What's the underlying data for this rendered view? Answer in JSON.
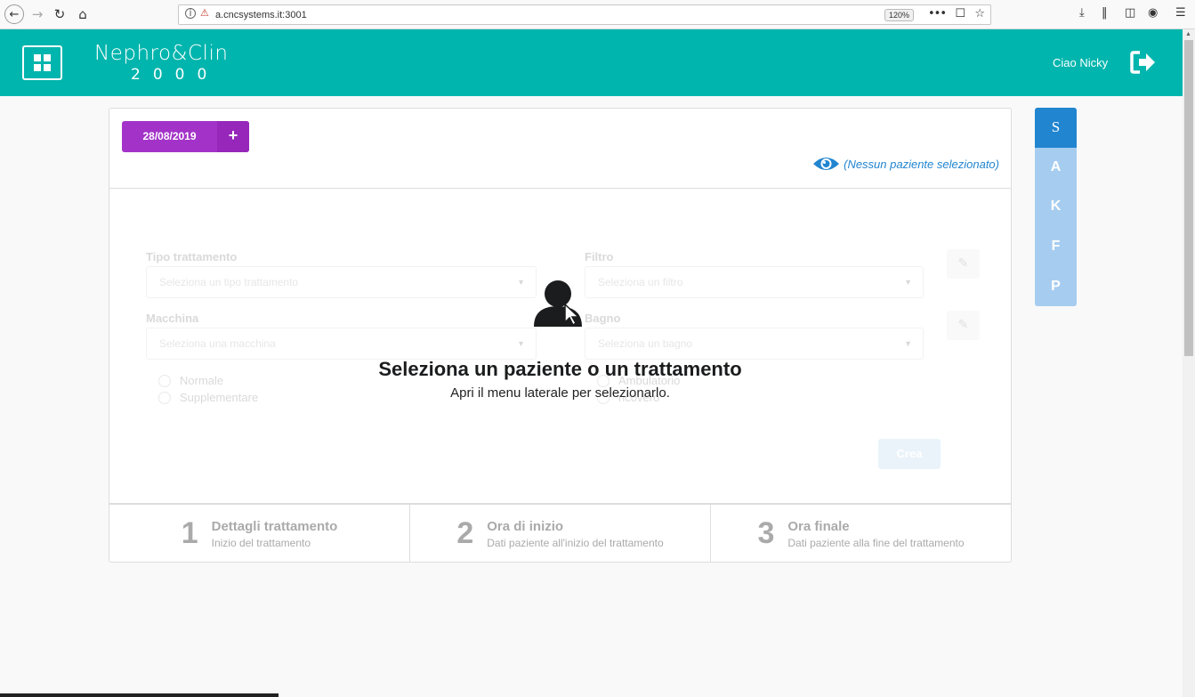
{
  "browser": {
    "url": "a.cncsystems.it:3001",
    "zoom": "120%",
    "more_glyph": "•••"
  },
  "header": {
    "logo_top": "Nephro&Clin",
    "logo_bottom": "2000",
    "greeting": "Ciao Nicky"
  },
  "panel": {
    "date_label": "28/08/2019",
    "add_glyph": "+",
    "patient_status": "(Nessun paziente selezionato)"
  },
  "form": {
    "treatment_label": "Tipo trattamento",
    "treatment_placeholder": "Seleziona un tipo trattamento",
    "filter_label": "Filtro",
    "filter_placeholder": "Seleziona un filtro",
    "machine_label": "Macchina",
    "machine_placeholder": "Seleziona una macchina",
    "bath_label": "Bagno",
    "bath_placeholder": "Seleziona un bagno",
    "radio_normal": "Normale",
    "radio_extra": "Supplementare",
    "radio_ambulatorio": "Ambulatorio",
    "radio_ricovero": "ricovero",
    "create_label": "Crea"
  },
  "overlay": {
    "title": "Seleziona un paziente o un trattamento",
    "subtitle": "Apri il menu laterale per selezionarlo."
  },
  "steps": [
    {
      "num": "1",
      "title": "Dettagli trattamento",
      "desc": "Inizio del trattamento"
    },
    {
      "num": "2",
      "title": "Ora di inizio",
      "desc": "Dati paziente all'inizio del trattamento"
    },
    {
      "num": "3",
      "title": "Ora finale",
      "desc": "Dati paziente alla fine del trattamento"
    }
  ],
  "side_tabs": [
    "S",
    "A",
    "K",
    "F",
    "P"
  ],
  "colors": {
    "header": "#00b5ad",
    "date_button": "#a333c8",
    "accent_blue": "#2185d0",
    "side_tabs_bg": "#a6cdf0"
  }
}
